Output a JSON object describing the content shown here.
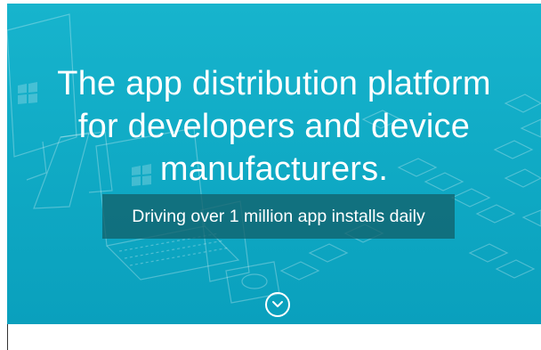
{
  "hero": {
    "headline": "The app distribution platform for developers and device manufacturers.",
    "tagline": "Driving over 1 million app installs daily",
    "scroll_icon": "chevron-down-circle-icon",
    "background_color": "#13afc9",
    "tagline_bg_color": "#12626c"
  }
}
